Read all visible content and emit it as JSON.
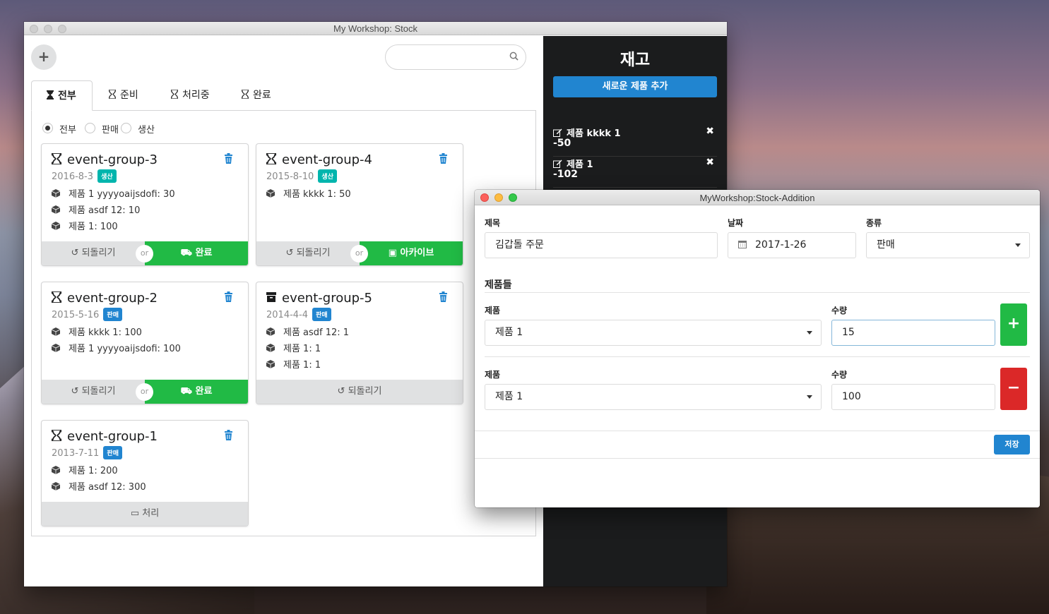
{
  "colors": {
    "accent_blue": "#2185d0",
    "success_green": "#21ba45",
    "danger_red": "#db2828",
    "teal_badge": "#00b5ad",
    "dark_panel": "#1b1c1d"
  },
  "main_window": {
    "title": "My Workshop: Stock",
    "add_button": "+",
    "search_placeholder": "",
    "tabs": [
      "전부",
      "준비",
      "처리중",
      "완료"
    ],
    "filters": [
      "전부",
      "판매",
      "생산"
    ],
    "or_label": "or",
    "cards": [
      {
        "title": "event-group-3",
        "date": "2016-8-3",
        "badge": "생산",
        "items": [
          "제품 1 yyyyoaijsdofi: 30",
          "제품 asdf 12: 10",
          "제품 1: 100"
        ],
        "left_btn": "되돌리기",
        "right_btn": "완료"
      },
      {
        "title": "event-group-4",
        "date": "2015-8-10",
        "badge": "생산",
        "items": [
          "제품 kkkk 1: 50"
        ],
        "left_btn": "되돌리기",
        "right_btn": "아카이브"
      },
      {
        "title": "event-group-2",
        "date": "2015-5-16",
        "badge": "판매",
        "items": [
          "제품 kkkk 1: 100",
          "제품 1 yyyyoaijsdofi: 100"
        ],
        "left_btn": "되돌리기",
        "right_btn": "완료"
      },
      {
        "title": "event-group-5",
        "date": "2014-4-4",
        "badge": "판매",
        "items": [
          "제품 asdf 12: 1",
          "제품 1: 1",
          "제품 1: 1"
        ],
        "full_btn": "되돌리기"
      },
      {
        "title": "event-group-1",
        "date": "2013-7-11",
        "badge": "판매",
        "items": [
          "제품 1: 200",
          "제품 asdf 12: 300"
        ],
        "full_btn": "처리"
      }
    ]
  },
  "stock_panel": {
    "title": "재고",
    "new_product_button": "새로운 제품 추가",
    "items": [
      {
        "name": "제품 kkkk 1",
        "qty": "-50"
      },
      {
        "name": "제품 1",
        "qty": "-102"
      }
    ]
  },
  "addition_window": {
    "title": "MyWorkshop:Stock-Addition",
    "title_label": "제목",
    "title_value": "김갑돌 주문",
    "date_label": "날짜",
    "date_value": "2017-1-26",
    "type_label": "종류",
    "type_value": "판매",
    "products_section": "제품들",
    "rows": [
      {
        "product_label": "제품",
        "product_value": "제품 1",
        "qty_label": "수량",
        "qty_value": "15",
        "action": "+"
      },
      {
        "product_label": "제품",
        "product_value": "제품 1",
        "qty_label": "수량",
        "qty_value": "100",
        "action": "−"
      }
    ],
    "save_button": "저장"
  }
}
